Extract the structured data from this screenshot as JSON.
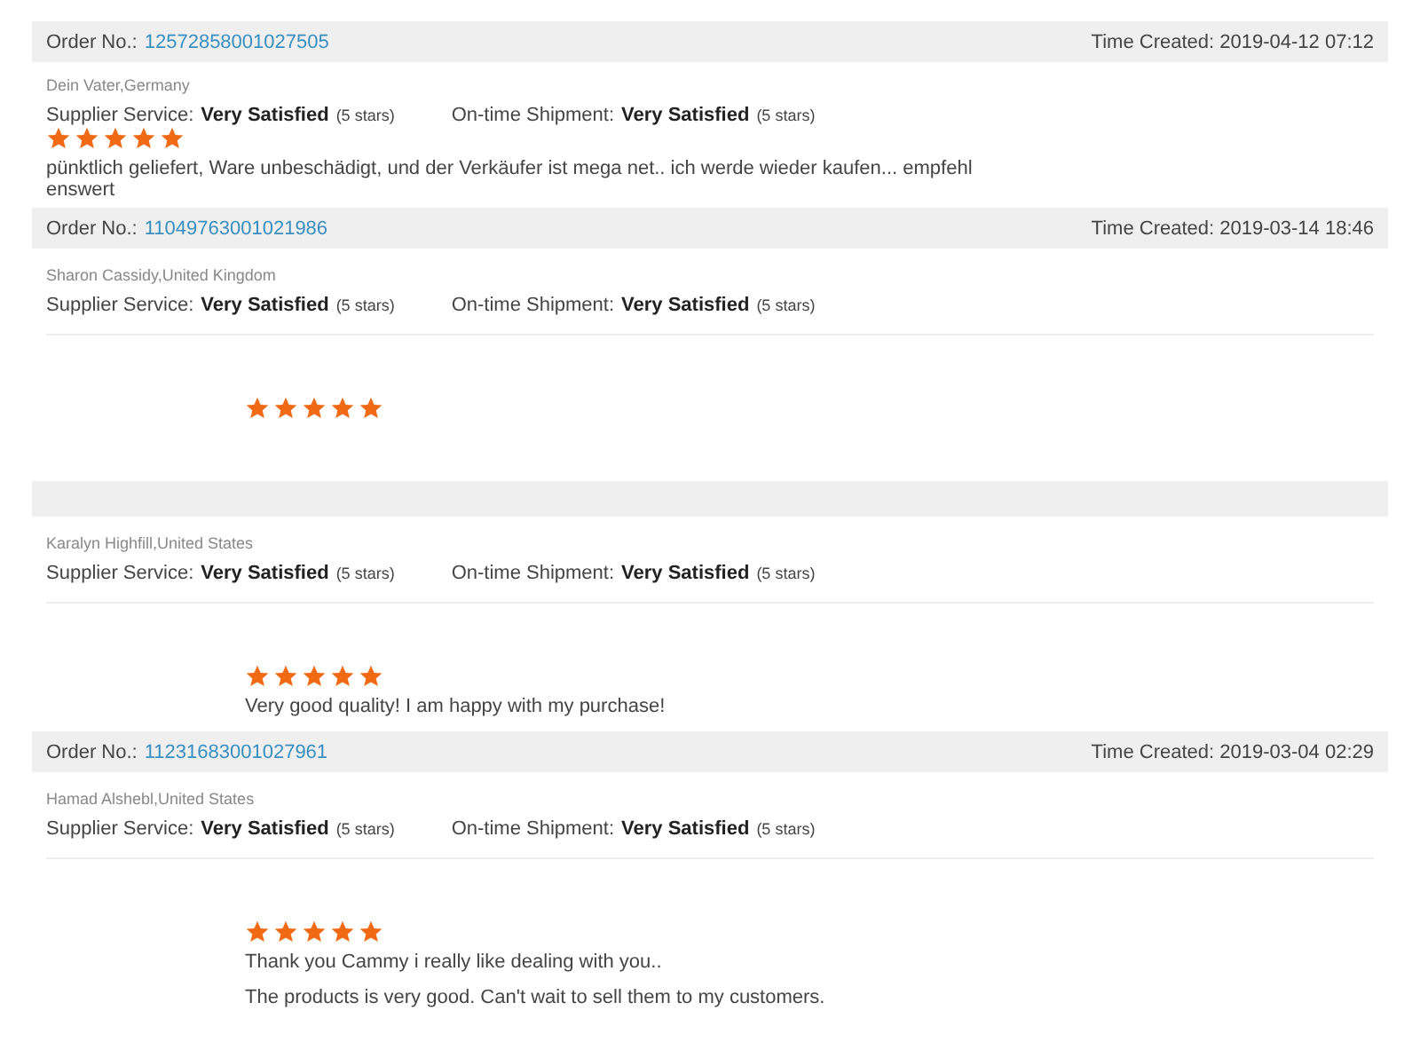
{
  "reviews": [
    {
      "kind": "compact",
      "header": {
        "order_label": "Order No.:",
        "order_no": "12572858001027505",
        "time": "Time Created: 2019-04-12 07:12"
      },
      "reviewer": "Dein Vater,Germany",
      "ratings": [
        {
          "label": "Supplier Service:",
          "value": "Very Satisfied",
          "note": "(5 stars)"
        },
        {
          "label": "On-time Shipment:",
          "value": "Very Satisfied",
          "note": "(5 stars)"
        }
      ],
      "stars": 5,
      "comment": [
        "pünktlich geliefert, Ware unbeschädigt, und der Verkäufer ist mega net.. ich werde wieder kaufen... empfehl enswert"
      ]
    },
    {
      "kind": "spaced",
      "header": {
        "order_label": "Order No.:",
        "order_no": "11049763001021986",
        "time": "Time Created: 2019-03-14 18:46"
      },
      "reviewer": "Sharon Cassidy,United Kingdom",
      "ratings": [
        {
          "label": "Supplier Service:",
          "value": "Very Satisfied",
          "note": "(5 stars)"
        },
        {
          "label": "On-time Shipment:",
          "value": "Very Satisfied",
          "note": "(5 stars)"
        }
      ],
      "stars": 5
    },
    {
      "kind": "spaced",
      "reviewer": "Karalyn Highfill,United States",
      "ratings": [
        {
          "label": "Supplier Service:",
          "value": "Very Satisfied",
          "note": "(5 stars)"
        },
        {
          "label": "On-time Shipment:",
          "value": "Very Satisfied",
          "note": "(5 stars)"
        }
      ],
      "stars": 5,
      "comment": [
        "Very good quality! I am happy with my purchase!"
      ]
    },
    {
      "kind": "spaced",
      "header": {
        "order_label": "Order No.:",
        "order_no": "11231683001027961",
        "time": "Time Created: 2019-03-04 02:29"
      },
      "reviewer": "Hamad Alshebl,United States",
      "ratings": [
        {
          "label": "Supplier Service:",
          "value": "Very Satisfied",
          "note": "(5 stars)"
        },
        {
          "label": "On-time Shipment:",
          "value": "Very Satisfied",
          "note": "(5 stars)"
        }
      ],
      "stars": 5,
      "comment": [
        "Thank you Cammy i really like dealing with you..",
        "The products is very good. Can't wait to sell them to my customers."
      ]
    }
  ]
}
